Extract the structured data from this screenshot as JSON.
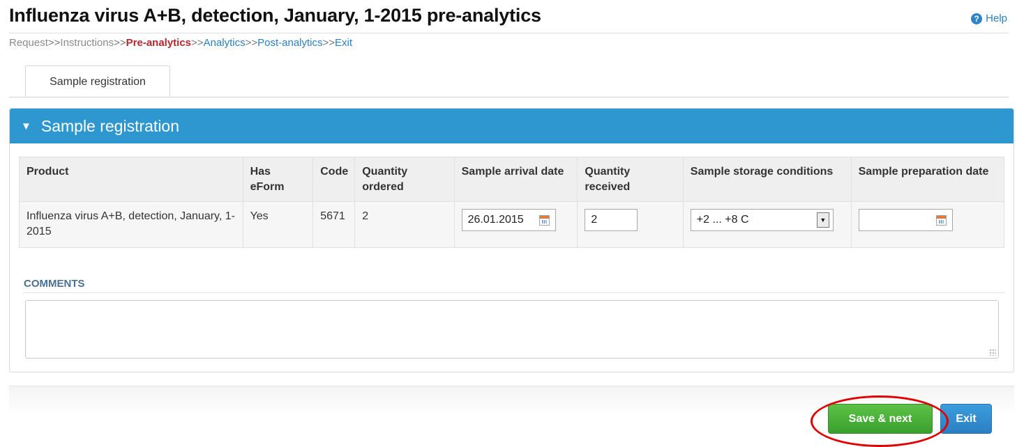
{
  "page": {
    "title": "Influenza virus A+B, detection, January, 1-2015 pre-analytics",
    "help_label": "Help",
    "help_icon": "?"
  },
  "breadcrumb": {
    "separator": ">>",
    "items": [
      "Request",
      "Instructions",
      "Pre-analytics",
      "Analytics",
      "Post-analytics",
      "Exit"
    ],
    "current": "Pre-analytics"
  },
  "tabs": [
    {
      "label": "Sample registration",
      "active": true
    }
  ],
  "panel": {
    "title": "Sample registration",
    "collapse_icon": "▼",
    "header_color": "#2f97cf"
  },
  "table": {
    "headers": {
      "product": "Product",
      "has_eform": "Has eForm",
      "code": "Code",
      "quantity_ordered": "Quantity ordered",
      "arrival_date": "Sample arrival date",
      "quantity_received": "Quantity received",
      "storage_conditions": "Sample storage conditions",
      "preparation_date": "Sample preparation date"
    },
    "row": {
      "product": "Influenza virus A+B, detection, January, 1-2015",
      "has_eform": "Yes",
      "code": "5671",
      "quantity_ordered": "2",
      "arrival_date": "26.01.2015",
      "quantity_received": "2",
      "storage_conditions": "+2 ... +8 C",
      "preparation_date": ""
    }
  },
  "comments": {
    "label": "COMMENTS",
    "value": ""
  },
  "buttons": {
    "save_next": "Save & next",
    "exit": "Exit"
  },
  "colors": {
    "save_button": "#4caf3a",
    "exit_button": "#2f8ed2",
    "highlight_ring": "#e00000",
    "current_crumb": "#b3282d"
  }
}
